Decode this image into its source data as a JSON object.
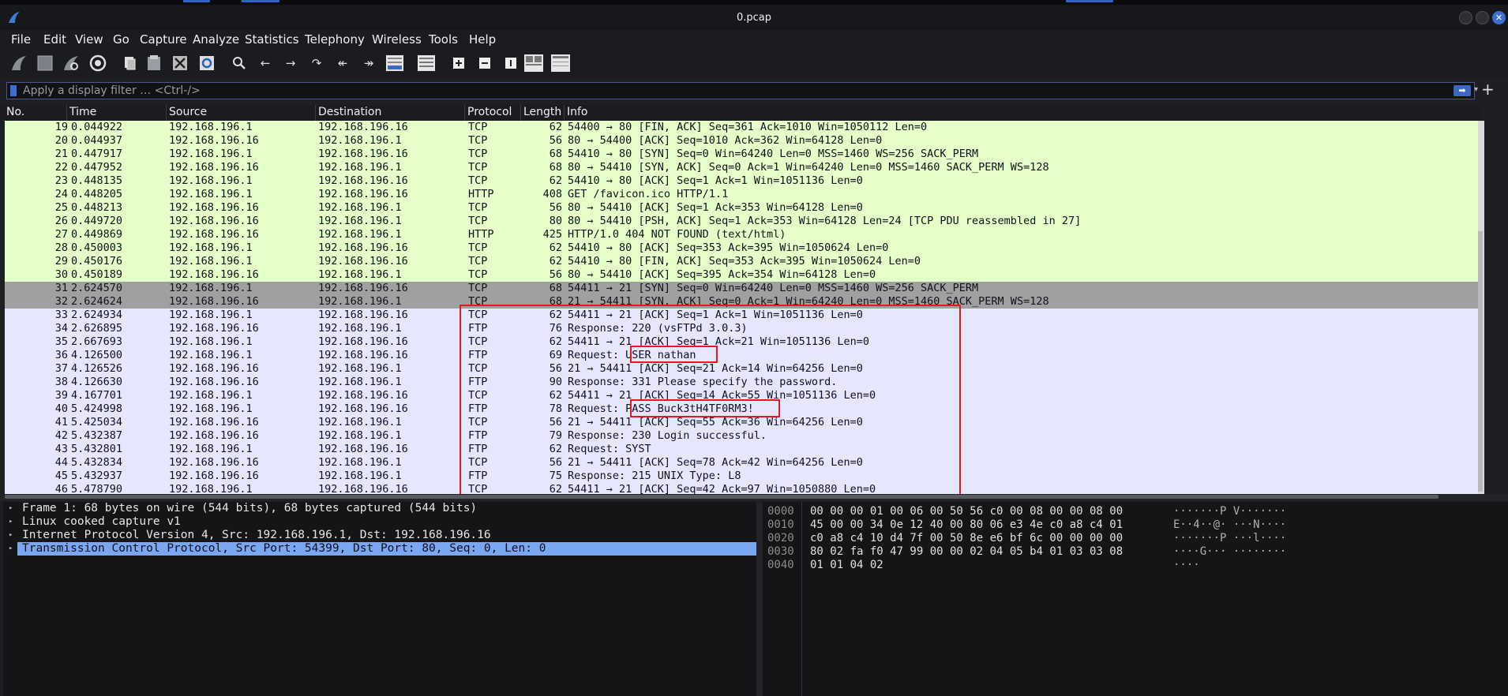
{
  "window": {
    "title": "0.pcap",
    "close_glyph": "✕"
  },
  "menu": [
    "File",
    "Edit",
    "View",
    "Go",
    "Capture",
    "Analyze",
    "Statistics",
    "Telephony",
    "Wireless",
    "Tools",
    "Help"
  ],
  "toolbar": {
    "icons": [
      "shark-fin-start-icon",
      "stop-capture-icon",
      "restart-capture-icon",
      "capture-options-icon",
      "open-file-icon",
      "save-file-icon",
      "close-file-icon",
      "reload-file-icon",
      "find-packet-icon",
      "go-back-icon",
      "go-forward-icon",
      "go-to-packet-icon",
      "go-first-icon",
      "go-last-icon",
      "autoscroll-icon",
      "colorize-icon",
      "zoom-in-icon",
      "zoom-out-icon",
      "normal-size-icon",
      "resize-columns-icon"
    ]
  },
  "filter": {
    "placeholder": "Apply a display filter … <Ctrl-/>",
    "plus": "+"
  },
  "packet_list": {
    "columns": [
      "No.",
      "Time",
      "Source",
      "Destination",
      "Protocol",
      "Length",
      "Info"
    ],
    "colors": {
      "tcp_http": "#e4ffc7",
      "selected_gray": "#a0a0a0",
      "ftp": "#e7e6ff"
    },
    "rows": [
      {
        "no": "19",
        "time": "0.044922",
        "src": "192.168.196.1",
        "dst": "192.168.196.16",
        "proto": "TCP",
        "len": "62",
        "info": "54400 → 80 [FIN, ACK] Seq=361 Ack=1010 Win=1050112 Len=0",
        "color": "tcp_http"
      },
      {
        "no": "20",
        "time": "0.044937",
        "src": "192.168.196.16",
        "dst": "192.168.196.1",
        "proto": "TCP",
        "len": "56",
        "info": "80 → 54400 [ACK] Seq=1010 Ack=362 Win=64128 Len=0",
        "color": "tcp_http"
      },
      {
        "no": "21",
        "time": "0.447917",
        "src": "192.168.196.1",
        "dst": "192.168.196.16",
        "proto": "TCP",
        "len": "68",
        "info": "54410 → 80 [SYN] Seq=0 Win=64240 Len=0 MSS=1460 WS=256 SACK_PERM",
        "color": "tcp_http"
      },
      {
        "no": "22",
        "time": "0.447952",
        "src": "192.168.196.16",
        "dst": "192.168.196.1",
        "proto": "TCP",
        "len": "68",
        "info": "80 → 54410 [SYN, ACK] Seq=0 Ack=1 Win=64240 Len=0 MSS=1460 SACK_PERM WS=128",
        "color": "tcp_http"
      },
      {
        "no": "23",
        "time": "0.448135",
        "src": "192.168.196.1",
        "dst": "192.168.196.16",
        "proto": "TCP",
        "len": "62",
        "info": "54410 → 80 [ACK] Seq=1 Ack=1 Win=1051136 Len=0",
        "color": "tcp_http"
      },
      {
        "no": "24",
        "time": "0.448205",
        "src": "192.168.196.1",
        "dst": "192.168.196.16",
        "proto": "HTTP",
        "len": "408",
        "info": "GET /favicon.ico HTTP/1.1",
        "color": "tcp_http"
      },
      {
        "no": "25",
        "time": "0.448213",
        "src": "192.168.196.16",
        "dst": "192.168.196.1",
        "proto": "TCP",
        "len": "56",
        "info": "80 → 54410 [ACK] Seq=1 Ack=353 Win=64128 Len=0",
        "color": "tcp_http"
      },
      {
        "no": "26",
        "time": "0.449720",
        "src": "192.168.196.16",
        "dst": "192.168.196.1",
        "proto": "TCP",
        "len": "80",
        "info": "80 → 54410 [PSH, ACK] Seq=1 Ack=353 Win=64128 Len=24 [TCP PDU reassembled in 27]",
        "color": "tcp_http"
      },
      {
        "no": "27",
        "time": "0.449869",
        "src": "192.168.196.16",
        "dst": "192.168.196.1",
        "proto": "HTTP",
        "len": "425",
        "info": "HTTP/1.0 404 NOT FOUND  (text/html)",
        "color": "tcp_http"
      },
      {
        "no": "28",
        "time": "0.450003",
        "src": "192.168.196.1",
        "dst": "192.168.196.16",
        "proto": "TCP",
        "len": "62",
        "info": "54410 → 80 [ACK] Seq=353 Ack=395 Win=1050624 Len=0",
        "color": "tcp_http"
      },
      {
        "no": "29",
        "time": "0.450176",
        "src": "192.168.196.1",
        "dst": "192.168.196.16",
        "proto": "TCP",
        "len": "62",
        "info": "54410 → 80 [FIN, ACK] Seq=353 Ack=395 Win=1050624 Len=0",
        "color": "tcp_http"
      },
      {
        "no": "30",
        "time": "0.450189",
        "src": "192.168.196.16",
        "dst": "192.168.196.1",
        "proto": "TCP",
        "len": "56",
        "info": "80 → 54410 [ACK] Seq=395 Ack=354 Win=64128 Len=0",
        "color": "tcp_http"
      },
      {
        "no": "31",
        "time": "2.624570",
        "src": "192.168.196.1",
        "dst": "192.168.196.16",
        "proto": "TCP",
        "len": "68",
        "info": "54411 → 21 [SYN] Seq=0 Win=64240 Len=0 MSS=1460 WS=256 SACK_PERM",
        "color": "selected_gray"
      },
      {
        "no": "32",
        "time": "2.624624",
        "src": "192.168.196.16",
        "dst": "192.168.196.1",
        "proto": "TCP",
        "len": "68",
        "info": "21 → 54411 [SYN, ACK] Seq=0 Ack=1 Win=64240 Len=0 MSS=1460 SACK_PERM WS=128",
        "color": "selected_gray"
      },
      {
        "no": "33",
        "time": "2.624934",
        "src": "192.168.196.1",
        "dst": "192.168.196.16",
        "proto": "TCP",
        "len": "62",
        "info": "54411 → 21 [ACK] Seq=1 Ack=1 Win=1051136 Len=0",
        "color": "ftp"
      },
      {
        "no": "34",
        "time": "2.626895",
        "src": "192.168.196.16",
        "dst": "192.168.196.1",
        "proto": "FTP",
        "len": "76",
        "info": "Response: 220 (vsFTPd 3.0.3)",
        "color": "ftp"
      },
      {
        "no": "35",
        "time": "2.667693",
        "src": "192.168.196.1",
        "dst": "192.168.196.16",
        "proto": "TCP",
        "len": "62",
        "info": "54411 → 21 [ACK] Seq=1 Ack=21 Win=1051136 Len=0",
        "color": "ftp"
      },
      {
        "no": "36",
        "time": "4.126500",
        "src": "192.168.196.1",
        "dst": "192.168.196.16",
        "proto": "FTP",
        "len": "69",
        "info": "Request: USER nathan",
        "color": "ftp"
      },
      {
        "no": "37",
        "time": "4.126526",
        "src": "192.168.196.16",
        "dst": "192.168.196.1",
        "proto": "TCP",
        "len": "56",
        "info": "21 → 54411 [ACK] Seq=21 Ack=14 Win=64256 Len=0",
        "color": "ftp"
      },
      {
        "no": "38",
        "time": "4.126630",
        "src": "192.168.196.16",
        "dst": "192.168.196.1",
        "proto": "FTP",
        "len": "90",
        "info": "Response: 331 Please specify the password.",
        "color": "ftp"
      },
      {
        "no": "39",
        "time": "4.167701",
        "src": "192.168.196.1",
        "dst": "192.168.196.16",
        "proto": "TCP",
        "len": "62",
        "info": "54411 → 21 [ACK] Seq=14 Ack=55 Win=1051136 Len=0",
        "color": "ftp"
      },
      {
        "no": "40",
        "time": "5.424998",
        "src": "192.168.196.1",
        "dst": "192.168.196.16",
        "proto": "FTP",
        "len": "78",
        "info": "Request: PASS Buck3tH4TF0RM3!",
        "color": "ftp"
      },
      {
        "no": "41",
        "time": "5.425034",
        "src": "192.168.196.16",
        "dst": "192.168.196.1",
        "proto": "TCP",
        "len": "56",
        "info": "21 → 54411 [ACK] Seq=55 Ack=36 Win=64256 Len=0",
        "color": "ftp"
      },
      {
        "no": "42",
        "time": "5.432387",
        "src": "192.168.196.16",
        "dst": "192.168.196.1",
        "proto": "FTP",
        "len": "79",
        "info": "Response: 230 Login successful.",
        "color": "ftp"
      },
      {
        "no": "43",
        "time": "5.432801",
        "src": "192.168.196.1",
        "dst": "192.168.196.16",
        "proto": "FTP",
        "len": "62",
        "info": "Request: SYST",
        "color": "ftp"
      },
      {
        "no": "44",
        "time": "5.432834",
        "src": "192.168.196.16",
        "dst": "192.168.196.1",
        "proto": "TCP",
        "len": "56",
        "info": "21 → 54411 [ACK] Seq=78 Ack=42 Win=64256 Len=0",
        "color": "ftp"
      },
      {
        "no": "45",
        "time": "5.432937",
        "src": "192.168.196.16",
        "dst": "192.168.196.1",
        "proto": "FTP",
        "len": "75",
        "info": "Response: 215 UNIX Type: L8",
        "color": "ftp"
      },
      {
        "no": "46",
        "time": "5.478790",
        "src": "192.168.196.1",
        "dst": "192.168.196.16",
        "proto": "TCP",
        "len": "62",
        "info": "54411 → 21 [ACK] Seq=42 Ack=97 Win=1050880 Len=0",
        "color": "ftp"
      }
    ]
  },
  "details": [
    {
      "text": "Frame 1: 68 bytes on wire (544 bits), 68 bytes captured (544 bits)",
      "selected": false
    },
    {
      "text": "Linux cooked capture v1",
      "selected": false
    },
    {
      "text": "Internet Protocol Version 4, Src: 192.168.196.1, Dst: 192.168.196.16",
      "selected": false
    },
    {
      "text": "Transmission Control Protocol, Src Port: 54399, Dst Port: 80, Seq: 0, Len: 0",
      "selected": true
    }
  ],
  "bytes": [
    {
      "offset": "0000",
      "hex": "00 00 00 01 00 06 00 50  56 c0 00 08 00 00 08 00",
      "ascii": "·······P V·······"
    },
    {
      "offset": "0010",
      "hex": "45 00 00 34 0e 12 40 00  80 06 e3 4e c0 a8 c4 01",
      "ascii": "E··4··@· ···N····"
    },
    {
      "offset": "0020",
      "hex": "c0 a8 c4 10 d4 7f 00 50  8e e6 bf 6c 00 00 00 00",
      "ascii": "·······P ···l····"
    },
    {
      "offset": "0030",
      "hex": "80 02 fa f0 47 99 00 00  02 04 05 b4 01 03 03 08",
      "ascii": "····G··· ········"
    },
    {
      "offset": "0040",
      "hex": "01 01 04 02",
      "ascii": "····"
    }
  ]
}
